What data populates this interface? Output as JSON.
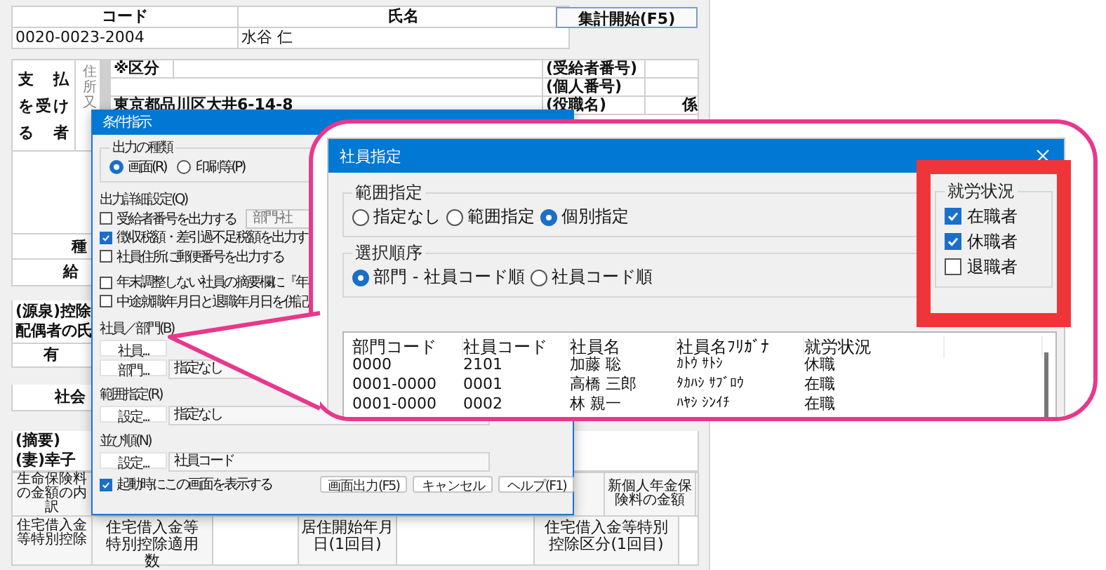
{
  "form": {
    "header_columns": [
      "コード",
      "氏名"
    ],
    "header_values": [
      "0020-0023-2004",
      "水谷 仁"
    ],
    "start_button": "集計開始(F5)",
    "payee_label_lines": [
      "支払",
      "を受け",
      "る者"
    ],
    "address_label": "住所又",
    "category_label": "※区分",
    "address": "東京都品川区大井6-14-8",
    "payee_fields": [
      "(受給者番号)",
      "(個人番号)",
      "(役職名)"
    ],
    "position_value": "係",
    "side_labels": [
      "種",
      "給",
      "(源泉)控除",
      "配偶者の氏",
      "有",
      "社会",
      "(摘要)",
      "(妻)幸子"
    ],
    "life_insurance": {
      "label": "生命保険料の金額の内訳",
      "right_label": "新個人年金保険料の金額"
    },
    "housing": {
      "label": "住宅借入金等特別控除",
      "cells": [
        "住宅借入金等特別控除適用数",
        "居住開始年月日(1回目)",
        "住宅借入金等特別控除区分(1回目)"
      ]
    }
  },
  "condition_dialog": {
    "title": "条件指示",
    "output_type": {
      "label": "出力の種類",
      "options": [
        {
          "label": "画面(R)",
          "selected": true
        },
        {
          "label": "印刷等(P)",
          "selected": false
        }
      ]
    },
    "detail": {
      "label": "出力詳細設定(Q)",
      "dropdown": "部門-社",
      "options": [
        {
          "label": "受給者番号を出力する",
          "checked": false
        },
        {
          "label": "徴収税額・差引過不足税額を出力す",
          "checked": true
        },
        {
          "label": "社員住所に郵便番号を出力する",
          "checked": false
        },
        {
          "label": "年末調整しない社員の摘要欄に『年",
          "checked": false
        },
        {
          "label": "中途就職年月日と退職年月日を併記",
          "checked": false
        }
      ]
    },
    "sections": [
      {
        "label": "社員／部門(B)",
        "rows": [
          {
            "button": "社員..."
          },
          {
            "button": "部門...",
            "value": "指定なし"
          }
        ]
      },
      {
        "label": "範囲指定(R)",
        "rows": [
          {
            "button": "設定...",
            "value": "指定なし"
          }
        ]
      },
      {
        "label": "並び順(N)",
        "rows": [
          {
            "button": "設定...",
            "value": "社員コード"
          }
        ]
      }
    ],
    "show_on_start": {
      "label": "起動時にこの画面を表示する",
      "checked": true
    },
    "buttons": [
      "画面出力(F5)",
      "キャンセル",
      "ヘルプ(F1)"
    ]
  },
  "employee_dialog": {
    "title": "社員指定",
    "range": {
      "label": "範囲指定",
      "options": [
        {
          "label": "指定なし",
          "selected": false
        },
        {
          "label": "範囲指定",
          "selected": false
        },
        {
          "label": "個別指定",
          "selected": true
        }
      ]
    },
    "order": {
      "label": "選択順序",
      "options": [
        {
          "label": "部門 - 社員コード順",
          "selected": true
        },
        {
          "label": "社員コード順",
          "selected": false
        }
      ]
    },
    "status_filter": {
      "label": "就労状況",
      "highlighted": true,
      "options": [
        {
          "label": "在職者",
          "checked": true
        },
        {
          "label": "休職者",
          "checked": true
        },
        {
          "label": "退職者",
          "checked": false
        }
      ]
    },
    "list": {
      "columns": [
        "部門コード",
        "社員コード",
        "社員名",
        "社員名ﾌﾘｶﾞﾅ",
        "就労状況"
      ],
      "rows": [
        [
          "0000",
          "2101",
          "加藤 聡",
          "ｶﾄｳ ｻﾄｼ",
          "休職"
        ],
        [
          "0001-0000",
          "0001",
          "高橋 三郎",
          "ﾀｶﾊｼ ｻﾌﾞﾛｳ",
          "在職"
        ],
        [
          "0001-0000",
          "0002",
          "林 親一",
          "ﾊﾔｼ ｼﾝｲﾁ",
          "在職"
        ]
      ]
    }
  }
}
